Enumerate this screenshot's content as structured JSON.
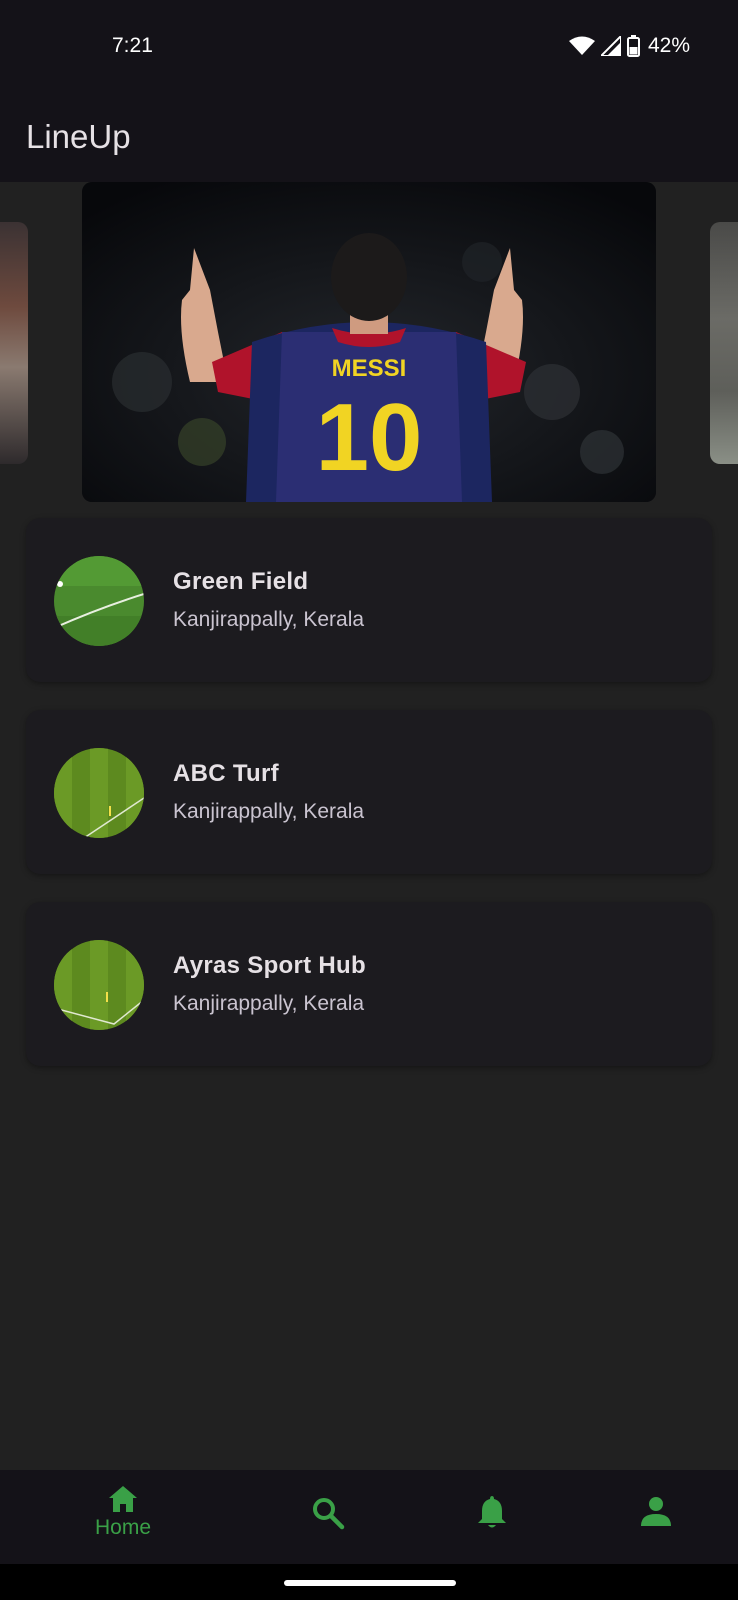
{
  "status_bar": {
    "time": "7:21",
    "battery": "42%",
    "icons": [
      "wifi-icon",
      "signal-icon",
      "battery-icon"
    ]
  },
  "app_bar": {
    "title": "LineUp"
  },
  "carousel": {
    "main_image": "messi-10-photo",
    "jersey_name": "MESSI",
    "jersey_number": "10"
  },
  "venues": [
    {
      "name": "Green Field",
      "location": "Kanjirappally, Kerala",
      "image": "turf-photo"
    },
    {
      "name": "ABC Turf",
      "location": "Kanjirappally, Kerala",
      "image": "turf-photo"
    },
    {
      "name": "Ayras Sport Hub",
      "location": "Kanjirappally, Kerala",
      "image": "turf-photo"
    }
  ],
  "bottom_nav": {
    "active_color": "#3aa047",
    "items": [
      {
        "label": "Home",
        "icon": "home-icon",
        "active": true
      },
      {
        "label": "",
        "icon": "search-icon"
      },
      {
        "label": "",
        "icon": "bell-icon"
      },
      {
        "label": "",
        "icon": "person-icon"
      }
    ]
  }
}
